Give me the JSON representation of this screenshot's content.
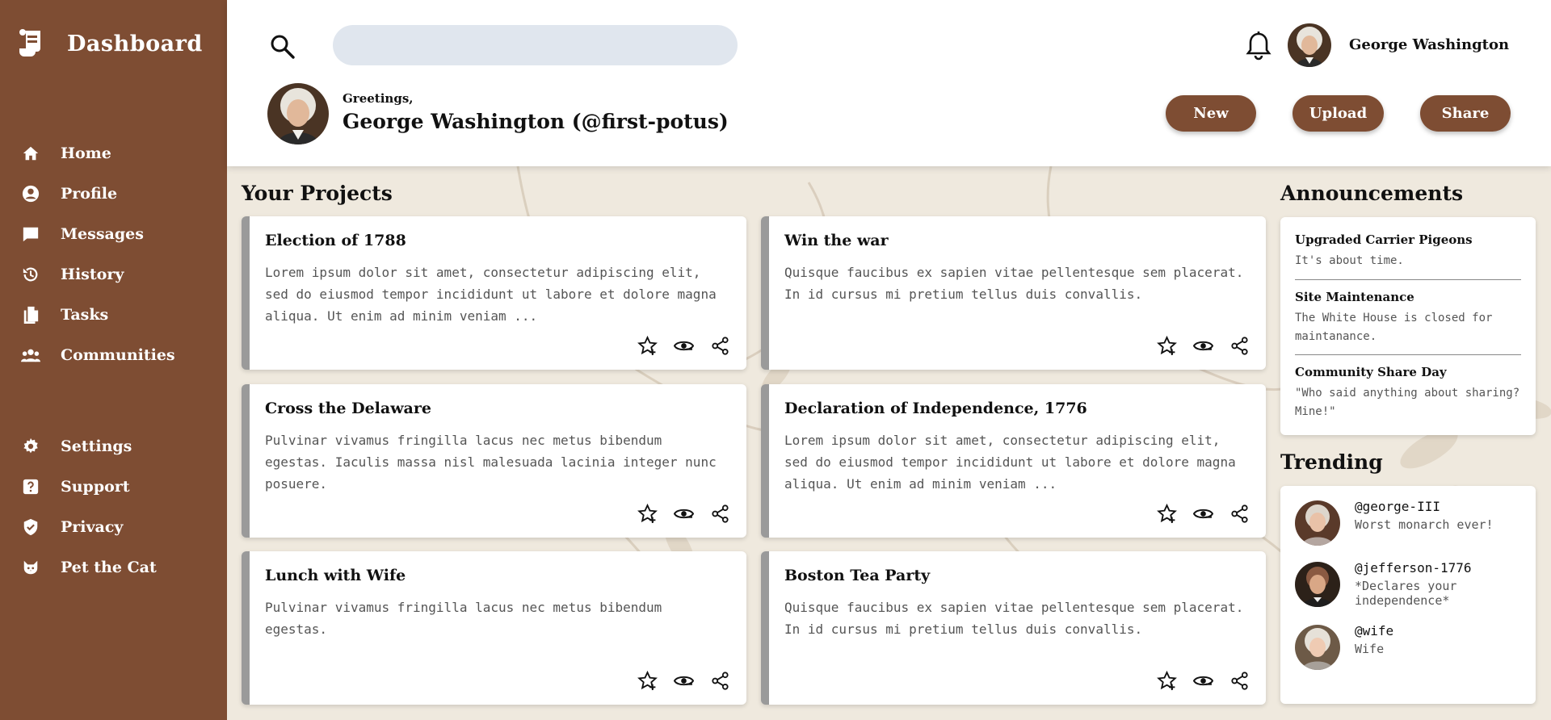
{
  "sidebar": {
    "brand": "Dashboard",
    "items": [
      {
        "label": "Home",
        "icon": "home-icon"
      },
      {
        "label": "Profile",
        "icon": "user-circle-icon"
      },
      {
        "label": "Messages",
        "icon": "message-icon"
      },
      {
        "label": "History",
        "icon": "history-icon"
      },
      {
        "label": "Tasks",
        "icon": "file-copy-icon"
      },
      {
        "label": "Communities",
        "icon": "group-icon"
      }
    ],
    "secondary_items": [
      {
        "label": "Settings",
        "icon": "gear-icon"
      },
      {
        "label": "Support",
        "icon": "help-icon"
      },
      {
        "label": "Privacy",
        "icon": "shield-check-icon"
      },
      {
        "label": "Pet the Cat",
        "icon": "cat-icon"
      }
    ]
  },
  "header": {
    "search": {
      "placeholder": "",
      "value": ""
    },
    "user_name": "George Washington",
    "greeting": "Greetings,",
    "greeting_name": "George Washington (@first-potus)",
    "buttons": {
      "new": "New",
      "upload": "Upload",
      "share": "Share"
    }
  },
  "projects": {
    "title": "Your Projects",
    "cards": [
      {
        "title": "Election of 1788",
        "body": "Lorem ipsum dolor sit amet, consectetur adipiscing elit, sed do eiusmod tempor incididunt ut labore et dolore magna aliqua. Ut enim ad minim veniam ..."
      },
      {
        "title": "Win the war",
        "body": "Quisque faucibus ex sapien vitae pellentesque sem placerat. In id cursus mi pretium tellus duis convallis."
      },
      {
        "title": "Cross the Delaware",
        "body": "Pulvinar vivamus fringilla lacus nec metus bibendum egestas. Iaculis massa nisl malesuada lacinia integer nunc posuere."
      },
      {
        "title": "Declaration of Independence, 1776",
        "body": "Lorem ipsum dolor sit amet, consectetur adipiscing elit, sed do eiusmod tempor incididunt ut labore et dolore magna aliqua. Ut enim ad minim veniam ..."
      },
      {
        "title": "Lunch with Wife",
        "body": "Pulvinar vivamus fringilla lacus nec metus bibendum egestas."
      },
      {
        "title": "Boston Tea Party",
        "body": "Quisque faucibus ex sapien vitae pellentesque sem placerat. In id cursus mi pretium tellus duis convallis."
      }
    ],
    "card_actions": [
      "star-add-icon",
      "eye-icon",
      "share-icon"
    ]
  },
  "announcements": {
    "title": "Announcements",
    "items": [
      {
        "title": "Upgraded Carrier Pigeons",
        "body": "It's about time."
      },
      {
        "title": "Site Maintenance",
        "body": "The White House is closed for maintanance."
      },
      {
        "title": "Community Share Day",
        "body": "\"Who said anything about sharing? Mine!\""
      }
    ]
  },
  "trending": {
    "title": "Trending",
    "items": [
      {
        "handle": "@george-III",
        "status": "Worst monarch ever!"
      },
      {
        "handle": "@jefferson-1776",
        "status": "*Declares your independence*"
      },
      {
        "handle": "@wife",
        "status": "Wife"
      }
    ]
  },
  "colors": {
    "sidebar": "#7e4d33",
    "accent_button": "#7e4d33",
    "card_border": "#9a9a9a",
    "search_bg": "#e0e6ee",
    "content_bg": "#efe9de"
  }
}
